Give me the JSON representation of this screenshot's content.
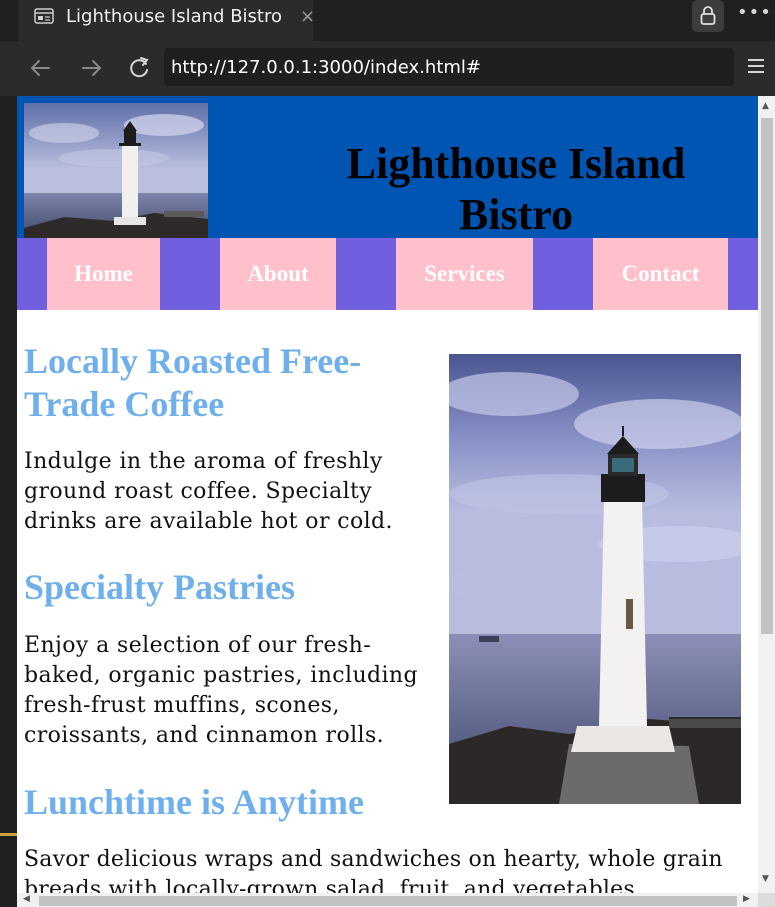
{
  "browser": {
    "tab_title": "Lighthouse Island Bistro",
    "tab_close": "×",
    "more_label": "•••",
    "url": "http://127.0.0.1:3000/index.html#"
  },
  "site": {
    "title": "Lighthouse Island Bistro",
    "nav": [
      "Home",
      "About",
      "Services",
      "Contact"
    ]
  },
  "sections": [
    {
      "heading": "Locally Roasted Free-Trade Coffee",
      "text": "Indulge in the aroma of freshly ground roast coffee. Specialty drinks are available hot or cold."
    },
    {
      "heading": "Specialty Pastries",
      "text": "Enjoy a selection of our fresh-baked, organic pastries, including fresh-frust muffins, scones, croissants, and cinnamon rolls."
    },
    {
      "heading": "Lunchtime is Anytime",
      "text": "Savor delicious wraps and sandwiches on hearty, whole grain breads with locally-grown salad, fruit, and vegetables."
    }
  ],
  "colors": {
    "header_bg": "#0055b3",
    "nav_bg": "#7060e0",
    "nav_item_bg": "#ffc0cb",
    "heading": "#6fb0ec"
  }
}
